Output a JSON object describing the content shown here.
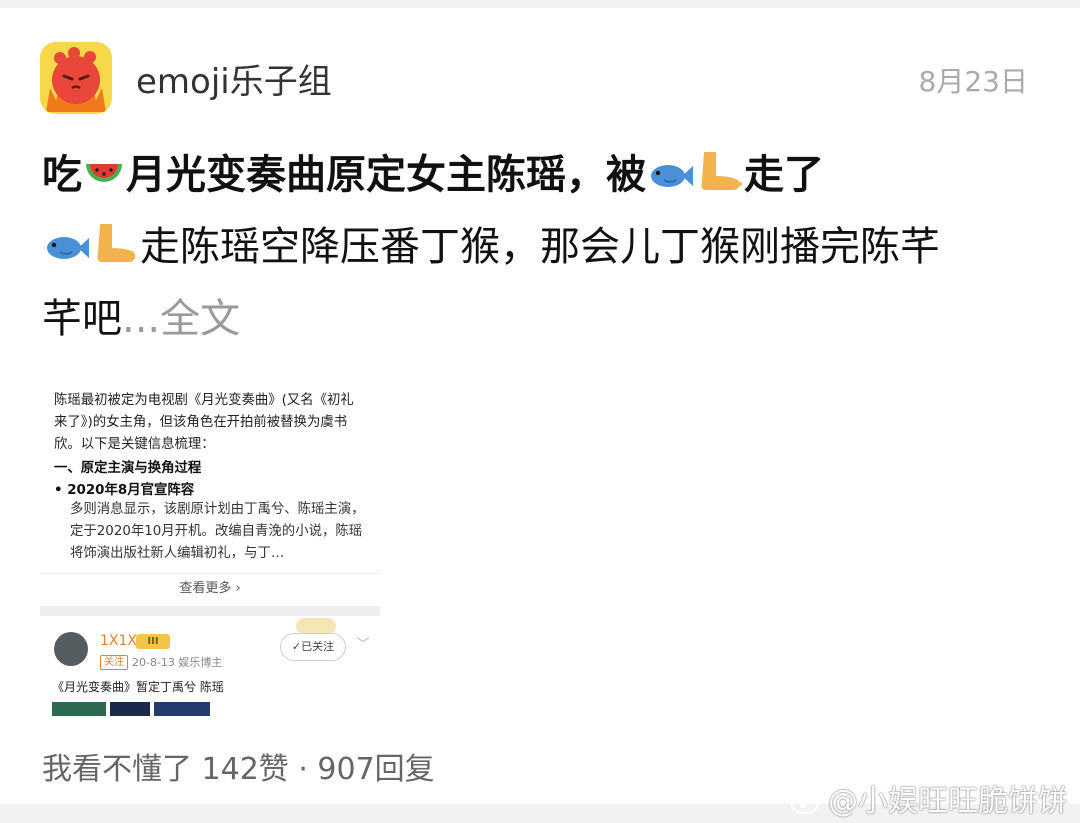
{
  "post": {
    "author": "emoji乐子组",
    "date": "8月23日",
    "bold_text": {
      "p1": "吃",
      "p2": "月光变奏曲原定女主陈瑶，被",
      "p3": "走了"
    },
    "body_text": {
      "p1": "走陈瑶空降压番丁猴，那会儿丁猴刚播完陈芊",
      "p2": "芊吧",
      "more": "...全文"
    },
    "emoji": [
      "watermelon-emoji",
      "fish-emoji",
      "foot-emoji"
    ],
    "footer": "我看不懂了 142赞 · 907回复"
  },
  "embedded_screenshot": {
    "text": "陈瑶最初被定为电视剧《月光变奏曲》(又名《初礼来了》)的女主角，但该角色在开拍前被替换为虞书欣。以下是关键信息梳理：",
    "heading": "一、原定主演与换角过程",
    "bullet": "• 2020年8月官宣阵容",
    "paragraph": "多则消息显示，该剧原计划由丁禹兮、陈瑶主演，定于2020年10月开机。改编自青浼的小说，陈瑶将饰演出版社新人编辑初礼，与丁…",
    "more": "查看更多 ›",
    "user": {
      "name": "1X1X",
      "level": "III",
      "follow_tag": "关注",
      "meta": "20-8-13 娱乐博主",
      "followed": "✓已关注",
      "post": "《月光变奏曲》暂定丁禹兮 陈瑶"
    }
  },
  "watermark": "@小娱旺旺脆饼饼"
}
